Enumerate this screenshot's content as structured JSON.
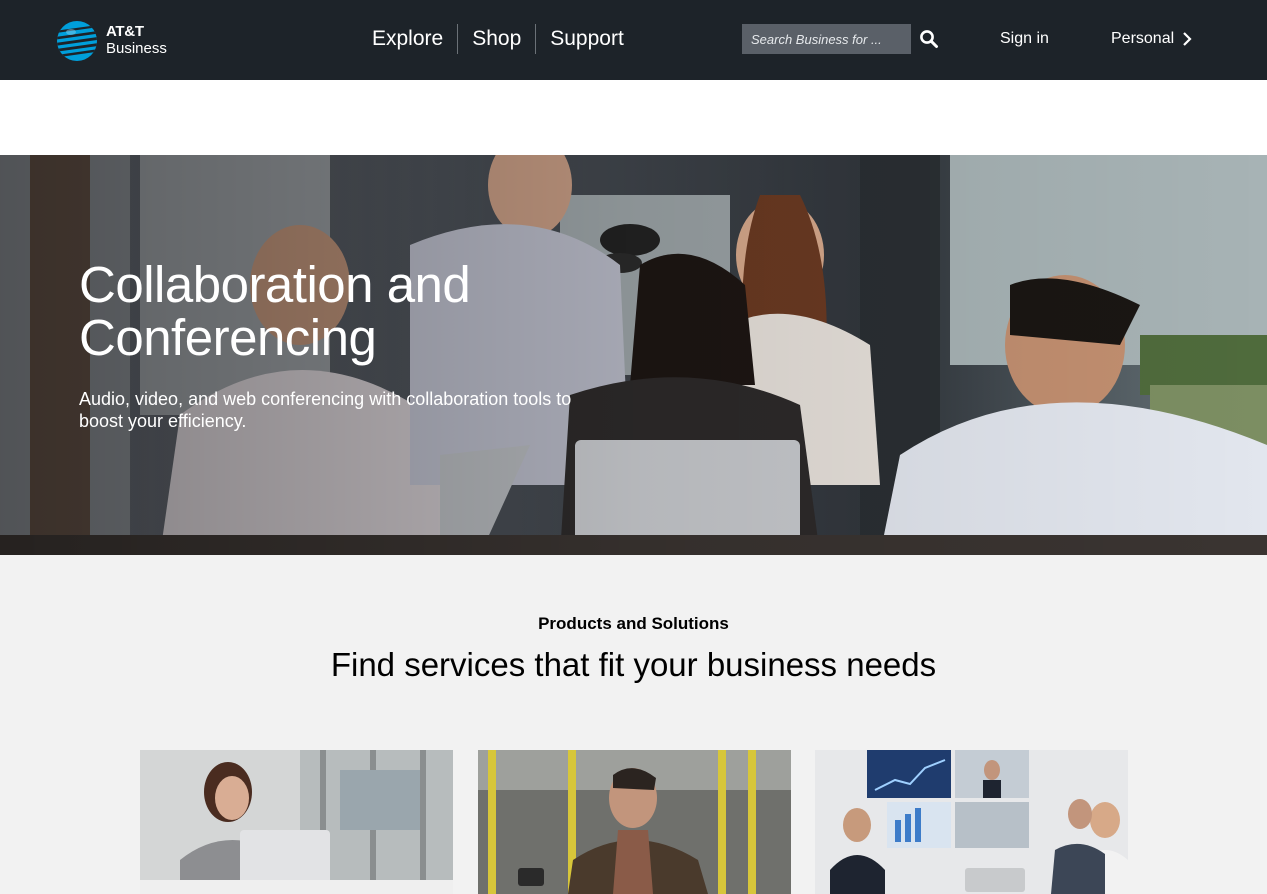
{
  "brand": {
    "line1": "AT&T",
    "line2": "Business",
    "color": "#009fdb"
  },
  "nav": {
    "items": [
      {
        "label": "Explore"
      },
      {
        "label": "Shop"
      },
      {
        "label": "Support"
      }
    ],
    "search_placeholder": "Search Business for ...",
    "search_icon": "search-icon",
    "signin_label": "Sign in",
    "personal_label": "Personal"
  },
  "hero": {
    "title_line1": "Collaboration and",
    "title_line2": "Conferencing",
    "subtitle": "Audio, video, and web conferencing with collaboration tools to boost your efficiency."
  },
  "products": {
    "eyebrow": "Products and Solutions",
    "title": "Find services that fit your business needs",
    "cards": [
      {
        "image": "woman-on-phone-with-laptop"
      },
      {
        "image": "man-on-bus-with-phone"
      },
      {
        "image": "video-conference-meeting"
      }
    ]
  },
  "colors": {
    "header_bg": "#1d2329",
    "section_bg": "#f2f2f2",
    "search_bg": "#5a6068"
  }
}
